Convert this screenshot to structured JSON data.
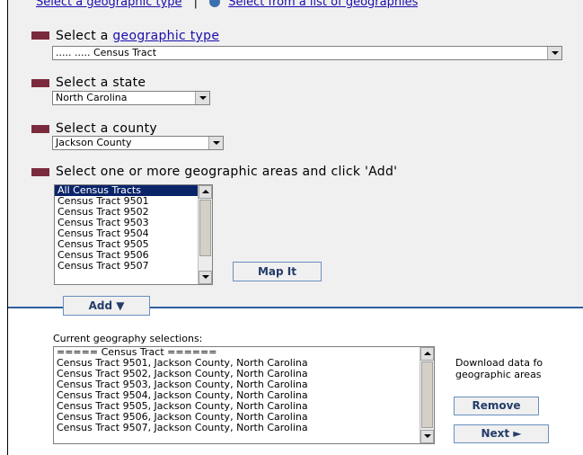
{
  "top_links": {
    "left": "Select a geographic type",
    "sep": "|",
    "right": "Select from a list of geographies"
  },
  "geo_type": {
    "label_prefix": "Select a ",
    "label_link": "geographic type",
    "value": "..... ..... Census Tract"
  },
  "state": {
    "label": "Select a state",
    "value": "North Carolina"
  },
  "county": {
    "label": "Select a county",
    "value": "Jackson County"
  },
  "areas": {
    "label": "Select one or more geographic areas and click 'Add'",
    "items": [
      "All Census Tracts",
      "Census Tract 9501",
      "Census Tract 9502",
      "Census Tract 9503",
      "Census Tract 9504",
      "Census Tract 9505",
      "Census Tract 9506",
      "Census Tract 9507"
    ],
    "selected_index": 0
  },
  "buttons": {
    "map_it": "Map It",
    "add": "Add ▼",
    "remove": "Remove",
    "next": "Next ►"
  },
  "selections": {
    "label": "Current geography selections:",
    "items": [
      "===== Census Tract ======",
      "Census Tract 9501, Jackson County, North Carolina",
      "Census Tract 9502, Jackson County, North Carolina",
      "Census Tract 9503, Jackson County, North Carolina",
      "Census Tract 9504, Jackson County, North Carolina",
      "Census Tract 9505, Jackson County, North Carolina",
      "Census Tract 9506, Jackson County, North Carolina",
      "Census Tract 9507, Jackson County, North Carolina"
    ]
  },
  "download_note": {
    "line1": "Download data fo",
    "line2": "geographic areas"
  },
  "colors": {
    "bullet": "#7a2a3c",
    "divider": "#2f5f9e",
    "highlight": "#0a246a",
    "link": "#1a0dab"
  }
}
